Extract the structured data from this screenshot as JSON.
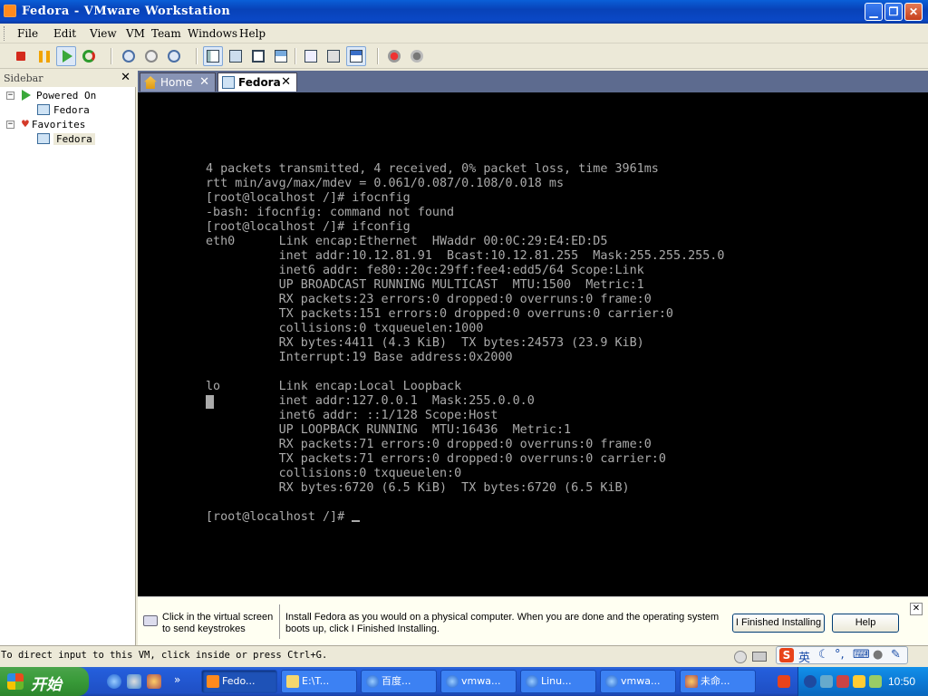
{
  "window": {
    "title": "Fedora - VMware Workstation"
  },
  "menu": [
    "File",
    "Edit",
    "View",
    "VM",
    "Team",
    "Windows",
    "Help"
  ],
  "toolbar": {
    "icons": [
      "power-off-icon",
      "suspend-icon",
      "power-on-icon",
      "reset-icon",
      "snapshot-icon",
      "revert-snapshot-icon",
      "snapshot-manager-icon",
      "show-sidebar-icon",
      "quick-switch-icon",
      "full-screen-icon",
      "unity-icon",
      "summary-icon",
      "console-icon",
      "appliance-view-icon",
      "record-icon",
      "replay-icon"
    ]
  },
  "sidebar": {
    "title": "Sidebar",
    "close": "✕",
    "groups": [
      {
        "label": "Powered On",
        "expander": "−",
        "items": [
          {
            "label": "Fedora"
          }
        ]
      },
      {
        "label": "Favorites",
        "expander": "−",
        "items": [
          {
            "label": "Fedora"
          }
        ]
      }
    ]
  },
  "tabs": [
    {
      "label": "Home",
      "close": "✕"
    },
    {
      "label": "Fedora",
      "close": "✕"
    }
  ],
  "console": {
    "lines": [
      "4 packets transmitted, 4 received, 0% packet loss, time 3961ms",
      "rtt min/avg/max/mdev = 0.061/0.087/0.108/0.018 ms",
      "[root@localhost /]# ifocnfig",
      "-bash: ifocnfig: command not found",
      "[root@localhost /]# ifconfig",
      "eth0      Link encap:Ethernet  HWaddr 00:0C:29:E4:ED:D5",
      "          inet addr:10.12.81.91  Bcast:10.12.81.255  Mask:255.255.255.0",
      "          inet6 addr: fe80::20c:29ff:fee4:edd5/64 Scope:Link",
      "          UP BROADCAST RUNNING MULTICAST  MTU:1500  Metric:1",
      "          RX packets:23 errors:0 dropped:0 overruns:0 frame:0",
      "          TX packets:151 errors:0 dropped:0 overruns:0 carrier:0",
      "          collisions:0 txqueuelen:1000",
      "          RX bytes:4411 (4.3 KiB)  TX bytes:24573 (23.9 KiB)",
      "          Interrupt:19 Base address:0x2000",
      "",
      "lo        Link encap:Local Loopback",
      "          inet addr:127.0.0.1  Mask:255.0.0.0",
      "          inet6 addr: ::1/128 Scope:Host",
      "          UP LOOPBACK RUNNING  MTU:16436  Metric:1",
      "          RX packets:71 errors:0 dropped:0 overruns:0 frame:0",
      "          TX packets:71 errors:0 dropped:0 overruns:0 carrier:0",
      "          collisions:0 txqueuelen:0",
      "          RX bytes:6720 (6.5 KiB)  TX bytes:6720 (6.5 KiB)",
      ""
    ],
    "prompt": "[root@localhost /]# "
  },
  "infobar": {
    "hint": "Click in the virtual screen to send keystrokes",
    "message": "Install Fedora as you would on a physical computer. When you are done and the operating system boots up, click I Finished Installing.",
    "finished_button": "I Finished Installing",
    "help_button": "Help",
    "close": "✕"
  },
  "statusbar": {
    "message": "To direct input to this VM, click inside or press Ctrl+G."
  },
  "ime": {
    "logo": "S",
    "mode": "英"
  },
  "taskbar": {
    "start": "开始",
    "tasks": [
      {
        "label": "Fedo..."
      },
      {
        "label": "E:\\T..."
      },
      {
        "label": "百度..."
      },
      {
        "label": "vmwa..."
      },
      {
        "label": "Linu..."
      },
      {
        "label": "vmwa..."
      },
      {
        "label": "未命..."
      }
    ],
    "overflow": "»",
    "clock": "10:50"
  },
  "colors": {
    "title_bar": "#0842b8",
    "console_bg": "#000000",
    "console_fg": "#aaaaaa",
    "tab_strip": "#5d6b8f",
    "taskbar": "#245edb",
    "start": "#389a38"
  }
}
